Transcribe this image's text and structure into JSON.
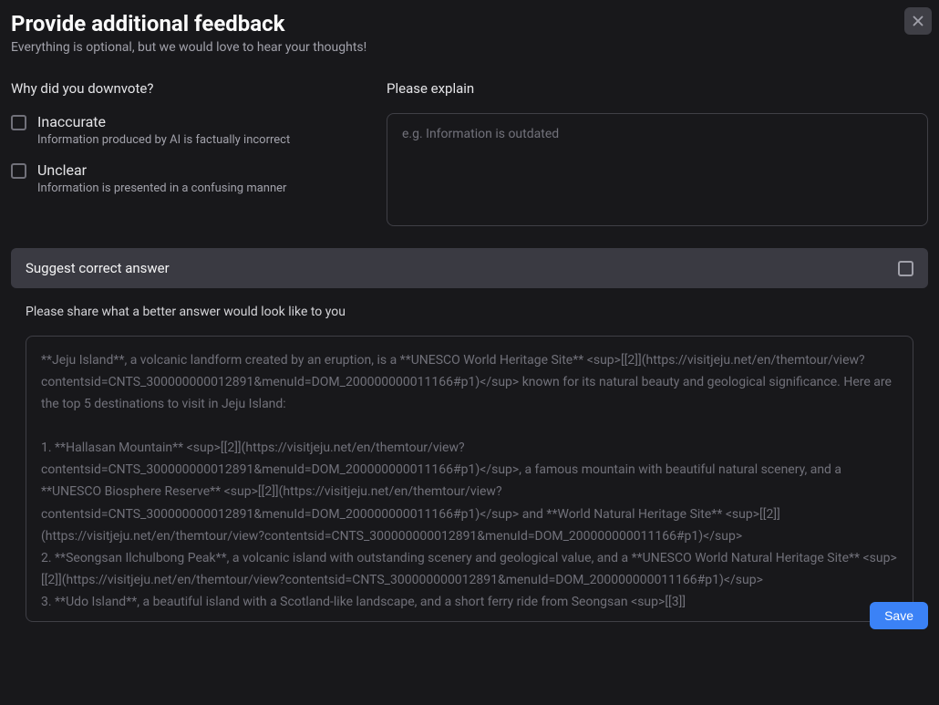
{
  "modal": {
    "title": "Provide additional feedback",
    "subtitle": "Everything is optional, but we would love to hear your thoughts!"
  },
  "downvote": {
    "question": "Why did you downvote?",
    "options": [
      {
        "label": "Inaccurate",
        "description": "Information produced by AI is factually incorrect"
      },
      {
        "label": "Unclear",
        "description": "Information is presented in a confusing manner"
      }
    ]
  },
  "explain": {
    "label": "Please explain",
    "placeholder": "e.g. Information is outdated",
    "value": ""
  },
  "suggest": {
    "header": "Suggest correct answer",
    "description": "Please share what a better answer would look like to you",
    "answer": "**Jeju Island**, a volcanic landform created by an eruption, is a **UNESCO World Heritage Site** <sup>[[2]](https://visitjeju.net/en/themtour/view?contentsid=CNTS_300000000012891&menuId=DOM_200000000011166#p1)</sup> known for its natural beauty and geological significance. Here are the top 5 destinations to visit in Jeju Island:\n\n1. **Hallasan Mountain** <sup>[[2]](https://visitjeju.net/en/themtour/view?contentsid=CNTS_300000000012891&menuId=DOM_200000000011166#p1)</sup>, a famous mountain with beautiful natural scenery, and a **UNESCO Biosphere Reserve** <sup>[[2]](https://visitjeju.net/en/themtour/view?contentsid=CNTS_300000000012891&menuId=DOM_200000000011166#p1)</sup> and **World Natural Heritage Site** <sup>[[2]](https://visitjeju.net/en/themtour/view?contentsid=CNTS_300000000012891&menuId=DOM_200000000011166#p1)</sup>\n2. **Seongsan Ilchulbong Peak**, a volcanic island with outstanding scenery and geological value, and a **UNESCO World Natural Heritage Site** <sup>[[2]](https://visitjeju.net/en/themtour/view?contentsid=CNTS_300000000012891&menuId=DOM_200000000011166#p1)</sup>\n3. **Udo Island**, a beautiful island with a Scotland-like landscape, and a short ferry ride from Seongsan <sup>[[3]]"
  },
  "footer": {
    "save": "Save"
  }
}
